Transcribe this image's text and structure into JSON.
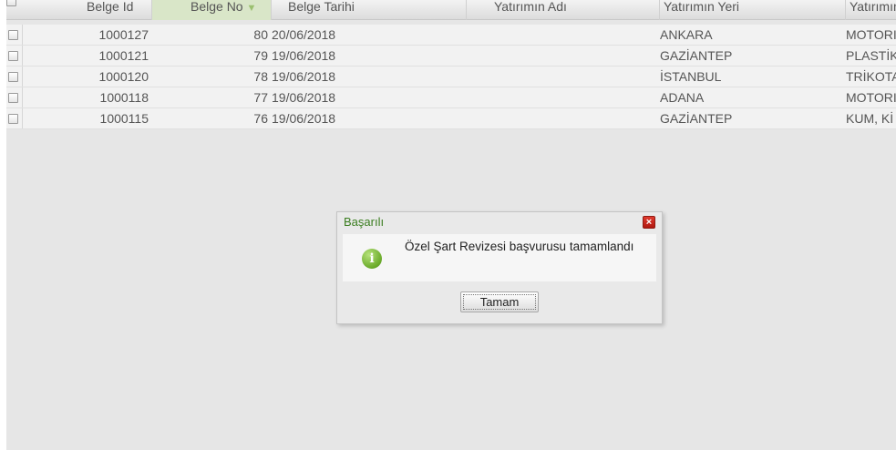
{
  "grid": {
    "columns": [
      {
        "key": "id",
        "label": "Belge Id"
      },
      {
        "key": "no",
        "label": "Belge No",
        "sorted": true
      },
      {
        "key": "date",
        "label": "Belge Tarihi"
      },
      {
        "key": "name",
        "label": "Yatırımın Adı"
      },
      {
        "key": "place",
        "label": "Yatırımın Yeri"
      },
      {
        "key": "type",
        "label": "Yatırımın"
      }
    ],
    "sort_indicator": "▼",
    "rows": [
      {
        "id": "1000127",
        "no": "80",
        "date": "20/06/2018",
        "name": "",
        "place": "ANKARA",
        "type": "MOTORI"
      },
      {
        "id": "1000121",
        "no": "79",
        "date": "19/06/2018",
        "name": "",
        "place": "GAZİANTEP",
        "type": "PLASTİK"
      },
      {
        "id": "1000120",
        "no": "78",
        "date": "19/06/2018",
        "name": "",
        "place": "İSTANBUL",
        "type": "TRİKOTA"
      },
      {
        "id": "1000118",
        "no": "77",
        "date": "19/06/2018",
        "name": "",
        "place": "ADANA",
        "type": "MOTORI"
      },
      {
        "id": "1000115",
        "no": "76",
        "date": "19/06/2018",
        "name": "",
        "place": "GAZİANTEP",
        "type": "KUM, Kİ"
      }
    ]
  },
  "dialog": {
    "title": "Başarılı",
    "close_glyph": "×",
    "icon_glyph": "i",
    "message": "Özel Şart Revizesi başvurusu tamamlandı",
    "ok_label": "Tamam"
  },
  "colors": {
    "title_green": "#3a7d1f",
    "close_red": "#c8261b",
    "info_green": "#6aaa2a",
    "sorted_header": "#d9e6c8"
  }
}
